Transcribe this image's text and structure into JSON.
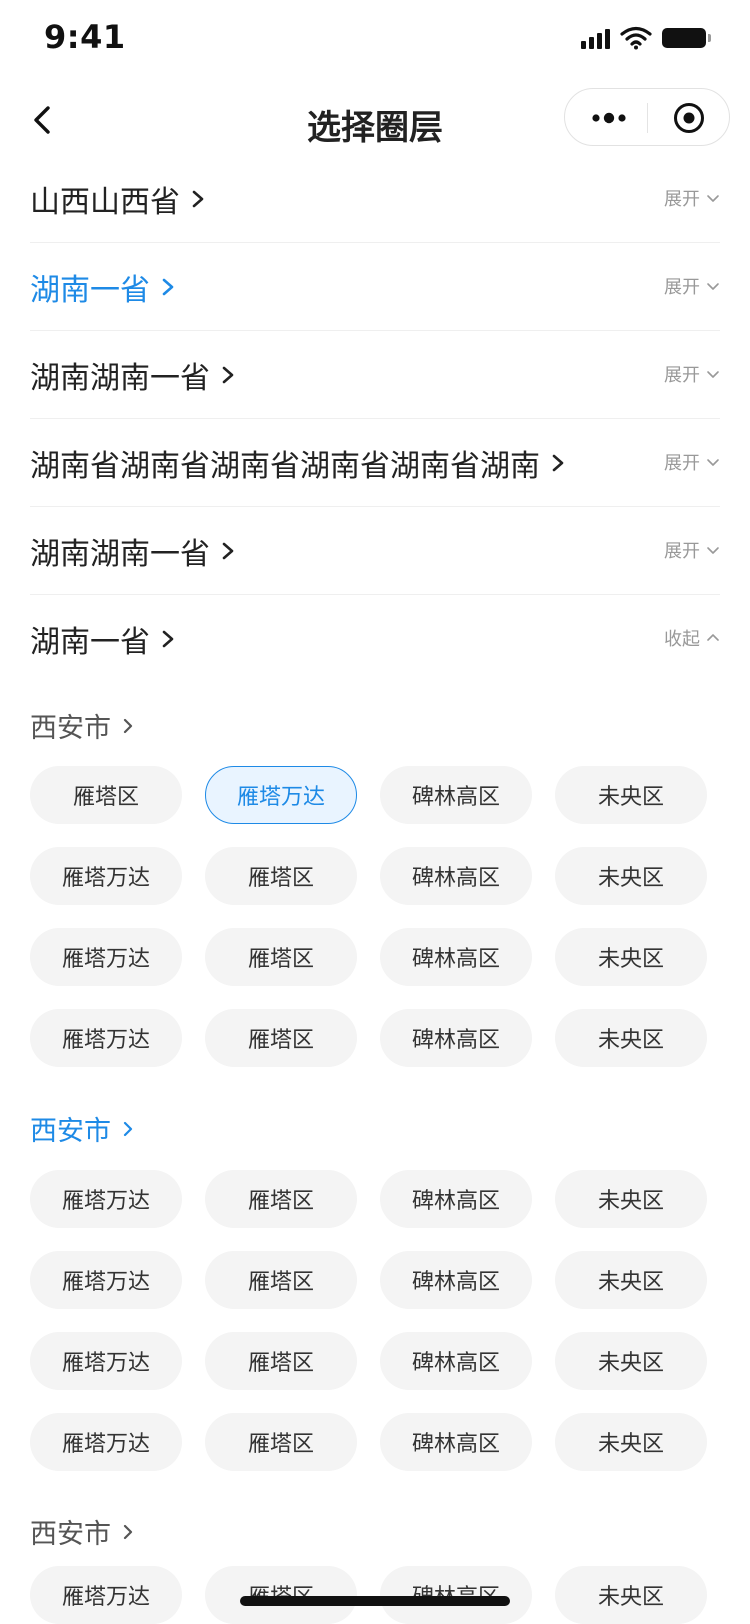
{
  "status_bar": {
    "time": "9:41"
  },
  "nav": {
    "title": "选择圈层"
  },
  "provinces": [
    {
      "name": "山西山西省",
      "toggle": "展开",
      "active": false
    },
    {
      "name": "湖南一省",
      "toggle": "展开",
      "active": true
    },
    {
      "name": "湖南湖南一省",
      "toggle": "展开",
      "active": false
    },
    {
      "name": "湖南省湖南省湖南省湖南省湖南省湖南",
      "toggle": "展开",
      "active": false
    },
    {
      "name": "湖南湖南一省",
      "toggle": "展开",
      "active": false
    },
    {
      "name": "湖南一省",
      "toggle": "收起",
      "active": false
    }
  ],
  "cities": [
    {
      "name": "西安市",
      "active": false,
      "districts": [
        "雁塔区",
        "雁塔万达",
        "碑林高区",
        "未央区",
        "雁塔万达",
        "雁塔区",
        "碑林高区",
        "未央区",
        "雁塔万达",
        "雁塔区",
        "碑林高区",
        "未央区",
        "雁塔万达",
        "雁塔区",
        "碑林高区",
        "未央区"
      ],
      "selected_district_index": 1
    },
    {
      "name": "西安市",
      "active": true,
      "districts": [
        "雁塔万达",
        "雁塔区",
        "碑林高区",
        "未央区",
        "雁塔万达",
        "雁塔区",
        "碑林高区",
        "未央区",
        "雁塔万达",
        "雁塔区",
        "碑林高区",
        "未央区",
        "雁塔万达",
        "雁塔区",
        "碑林高区",
        "未央区"
      ]
    },
    {
      "name": "西安市",
      "active": false,
      "districts": [
        "雁塔万达",
        "雁塔区",
        "碑林高区",
        "未央区"
      ]
    }
  ],
  "colors": {
    "accent": "#1e8ae6",
    "chip_bg": "#f4f4f4",
    "selected_chip_bg": "#e9f4ff"
  }
}
